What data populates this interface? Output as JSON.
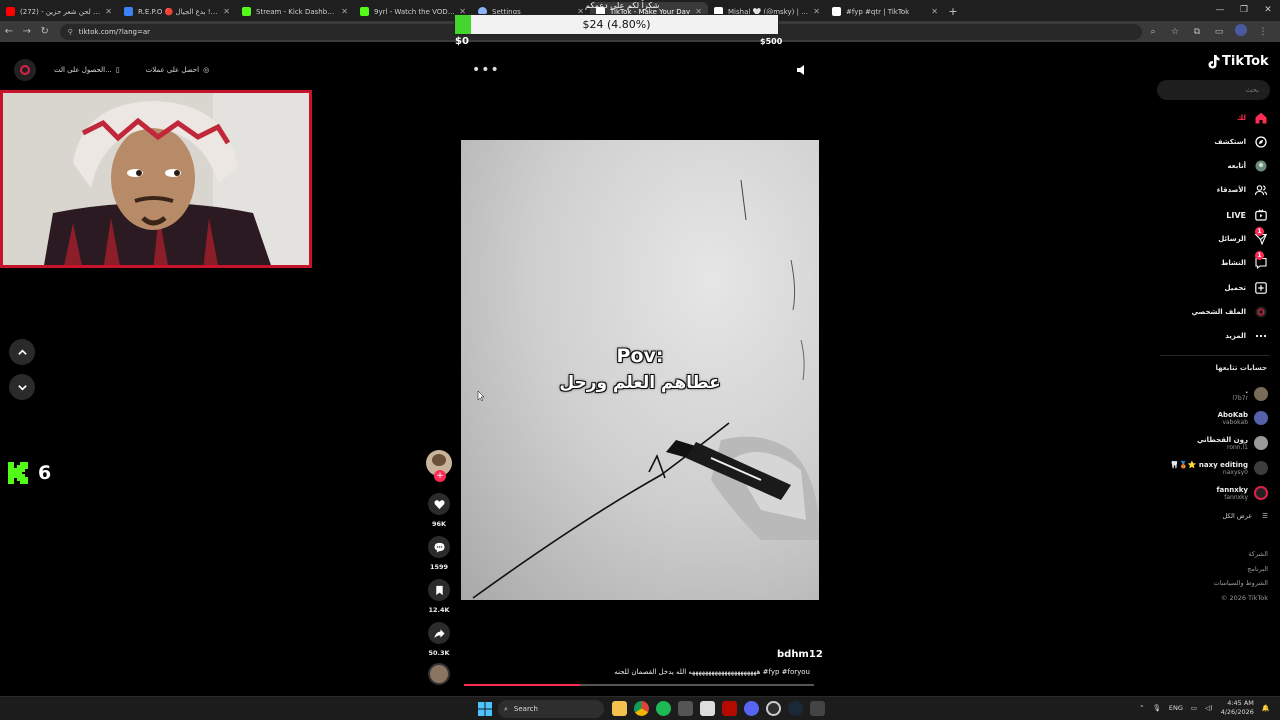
{
  "browser": {
    "tabs": [
      {
        "title": "لحن شعر حزين - (272) Tube",
        "color": "#ff0000",
        "active": false
      },
      {
        "title": "R.E.P.O 🔴 بدع الجيال !! - Reti",
        "color": "#3b82f6",
        "active": false
      },
      {
        "title": "Stream - Kick Dashboard",
        "color": "#53fc18",
        "active": false
      },
      {
        "title": "9yrl - Watch the VOD on Kick",
        "color": "#53fc18",
        "active": false
      },
      {
        "title": "Settings",
        "color": "#8ab4f8",
        "active": false
      },
      {
        "title": "TikTok - Make Your Day",
        "color": "#ffffff",
        "active": true
      },
      {
        "title": "Mishal 🤍 (@msky) | TikTok",
        "color": "#ffffff",
        "active": false
      },
      {
        "title": "#fyp #qtr | TikTok",
        "color": "#ffffff",
        "active": false
      }
    ],
    "url": "tiktok.com/?lang=ar"
  },
  "overlay": {
    "top_text": "شكراً لكم على دعمكم",
    "goal_label": "$24 (4.80%)",
    "goal_progress": 0.048,
    "goal_min": "$0",
    "goal_max": "$500",
    "kick_count": "6",
    "colors": {
      "kick": "#53fc18",
      "cam_border": "#c8142a"
    }
  },
  "tiktok": {
    "brand": "TikTok",
    "get_coins": "احصل على عملات",
    "get_app": "الحصول على الت...",
    "search_placeholder": "بحث",
    "nav": [
      {
        "label": "لك",
        "icon": "home-icon",
        "active": true
      },
      {
        "label": "استكشف",
        "icon": "compass-icon",
        "active": false
      },
      {
        "label": "أتابعه",
        "icon": "following-avatar-icon",
        "active": false
      },
      {
        "label": "الأصدقاء",
        "icon": "friends-icon",
        "active": false
      },
      {
        "label": "LIVE",
        "icon": "live-icon",
        "active": false
      },
      {
        "label": "الرسائل",
        "icon": "messages-icon",
        "active": false,
        "badge": "1"
      },
      {
        "label": "النشاط",
        "icon": "activity-icon",
        "active": false,
        "badge": "1"
      },
      {
        "label": "تحميل",
        "icon": "upload-icon",
        "active": false
      },
      {
        "label": "الملف الشخصي",
        "icon": "profile-icon",
        "active": false
      },
      {
        "label": "المزيد",
        "icon": "more-icon",
        "active": false
      }
    ],
    "following_heading": "حسابات تتابعها",
    "following": [
      {
        "name": ".",
        "handle": "l7b7r"
      },
      {
        "name": "AboKab",
        "handle": "vabokab"
      },
      {
        "name": "رون القحطاني",
        "handle": "ronn.l1"
      },
      {
        "name": "🦷🥉⭐ naxy editing",
        "handle": "naxysy0"
      },
      {
        "name": "fannxky",
        "handle": "fannxky"
      }
    ],
    "see_all": "عرض الكل",
    "footer": [
      "الشركة",
      "البرنامج",
      "الشروط والسياسات",
      "© 2026 TikTok"
    ],
    "video": {
      "overlay_line1": "Pov:",
      "overlay_line2": "عطاهم العلم ورحل",
      "author": "bdhm12",
      "caption": "هههههههههههههههههههههه الله يدخل القصمان للجنه #fyp #foryou",
      "progress": 0.33
    },
    "actions": {
      "likes": "96K",
      "comments": "1599",
      "saves": "12.4K",
      "shares": "50.3K"
    },
    "accent": "#fe2c55"
  },
  "taskbar": {
    "search_label": "Search",
    "lang": "ENG",
    "time": "4:45 AM",
    "date": "4/26/2026"
  }
}
